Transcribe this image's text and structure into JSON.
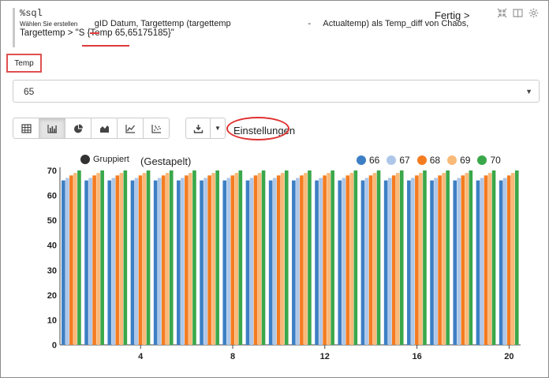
{
  "code": {
    "magic": "%sql",
    "line1_small": "Wählen Sie erstellen",
    "line1_main": "gID Datum, Targettemp (targettemp",
    "line1_dash": "-",
    "line1_end": "Actualtemp) als Temp_diff von Chaos,",
    "line2": "Targettemp > \"S {Temp 65,65175185}\""
  },
  "status": {
    "label": "Fertig >"
  },
  "form": {
    "label": "Temp",
    "select_value": "65"
  },
  "toolbar": {
    "buttons": [
      "table-icon",
      "bar-chart-icon",
      "pie-chart-icon",
      "area-chart-icon",
      "line-chart-icon",
      "scatter-chart-icon"
    ],
    "active_index": 1,
    "download_icon": "download-icon",
    "settings_label": "Einstellungen"
  },
  "chart_data": {
    "type": "bar",
    "mode_options": [
      "Gruppiert",
      "(Gestapelt)"
    ],
    "selected_mode": "Gruppiert",
    "x": [
      1,
      2,
      3,
      4,
      5,
      6,
      7,
      8,
      9,
      10,
      11,
      12,
      13,
      14,
      15,
      16,
      17,
      18,
      19,
      20
    ],
    "x_tick_labels": [
      "4",
      "8",
      "12",
      "16",
      "20"
    ],
    "y_tick_labels": [
      "0",
      "10",
      "20",
      "30",
      "40",
      "50",
      "60",
      "70"
    ],
    "ylim": [
      0,
      70
    ],
    "series": [
      {
        "name": "66",
        "color": "#3d7fc4",
        "value": 66
      },
      {
        "name": "67",
        "color": "#aec7e8",
        "value": 67
      },
      {
        "name": "68",
        "color": "#f47c20",
        "value": 68
      },
      {
        "name": "69",
        "color": "#f9b978",
        "value": 69
      },
      {
        "name": "70",
        "color": "#3aa84a",
        "value": 70
      }
    ]
  }
}
